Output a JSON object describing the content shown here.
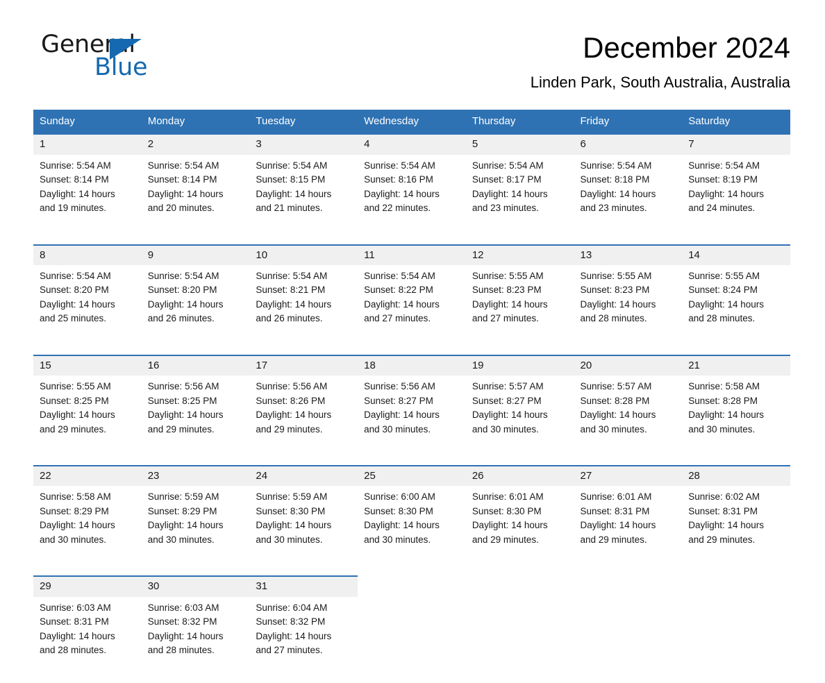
{
  "brand": {
    "name_part1": "General",
    "name_part2": "Blue",
    "flag_icon": "triangle-flag-icon",
    "accent_color": "#1569b0"
  },
  "header": {
    "title": "December 2024",
    "subtitle": "Linden Park, South Australia, Australia"
  },
  "colors": {
    "header_blue": "#2e72b4",
    "daynum_band": "#f0f0f0",
    "text": "#1a1a1a"
  },
  "calendar": {
    "weekday_headers": [
      "Sunday",
      "Monday",
      "Tuesday",
      "Wednesday",
      "Thursday",
      "Friday",
      "Saturday"
    ],
    "weeks": [
      {
        "days": [
          {
            "date": "1",
            "sunrise": "Sunrise: 5:54 AM",
            "sunset": "Sunset: 8:14 PM",
            "daylight_line1": "Daylight: 14 hours",
            "daylight_line2": "and 19 minutes."
          },
          {
            "date": "2",
            "sunrise": "Sunrise: 5:54 AM",
            "sunset": "Sunset: 8:14 PM",
            "daylight_line1": "Daylight: 14 hours",
            "daylight_line2": "and 20 minutes."
          },
          {
            "date": "3",
            "sunrise": "Sunrise: 5:54 AM",
            "sunset": "Sunset: 8:15 PM",
            "daylight_line1": "Daylight: 14 hours",
            "daylight_line2": "and 21 minutes."
          },
          {
            "date": "4",
            "sunrise": "Sunrise: 5:54 AM",
            "sunset": "Sunset: 8:16 PM",
            "daylight_line1": "Daylight: 14 hours",
            "daylight_line2": "and 22 minutes."
          },
          {
            "date": "5",
            "sunrise": "Sunrise: 5:54 AM",
            "sunset": "Sunset: 8:17 PM",
            "daylight_line1": "Daylight: 14 hours",
            "daylight_line2": "and 23 minutes."
          },
          {
            "date": "6",
            "sunrise": "Sunrise: 5:54 AM",
            "sunset": "Sunset: 8:18 PM",
            "daylight_line1": "Daylight: 14 hours",
            "daylight_line2": "and 23 minutes."
          },
          {
            "date": "7",
            "sunrise": "Sunrise: 5:54 AM",
            "sunset": "Sunset: 8:19 PM",
            "daylight_line1": "Daylight: 14 hours",
            "daylight_line2": "and 24 minutes."
          }
        ]
      },
      {
        "days": [
          {
            "date": "8",
            "sunrise": "Sunrise: 5:54 AM",
            "sunset": "Sunset: 8:20 PM",
            "daylight_line1": "Daylight: 14 hours",
            "daylight_line2": "and 25 minutes."
          },
          {
            "date": "9",
            "sunrise": "Sunrise: 5:54 AM",
            "sunset": "Sunset: 8:20 PM",
            "daylight_line1": "Daylight: 14 hours",
            "daylight_line2": "and 26 minutes."
          },
          {
            "date": "10",
            "sunrise": "Sunrise: 5:54 AM",
            "sunset": "Sunset: 8:21 PM",
            "daylight_line1": "Daylight: 14 hours",
            "daylight_line2": "and 26 minutes."
          },
          {
            "date": "11",
            "sunrise": "Sunrise: 5:54 AM",
            "sunset": "Sunset: 8:22 PM",
            "daylight_line1": "Daylight: 14 hours",
            "daylight_line2": "and 27 minutes."
          },
          {
            "date": "12",
            "sunrise": "Sunrise: 5:55 AM",
            "sunset": "Sunset: 8:23 PM",
            "daylight_line1": "Daylight: 14 hours",
            "daylight_line2": "and 27 minutes."
          },
          {
            "date": "13",
            "sunrise": "Sunrise: 5:55 AM",
            "sunset": "Sunset: 8:23 PM",
            "daylight_line1": "Daylight: 14 hours",
            "daylight_line2": "and 28 minutes."
          },
          {
            "date": "14",
            "sunrise": "Sunrise: 5:55 AM",
            "sunset": "Sunset: 8:24 PM",
            "daylight_line1": "Daylight: 14 hours",
            "daylight_line2": "and 28 minutes."
          }
        ]
      },
      {
        "days": [
          {
            "date": "15",
            "sunrise": "Sunrise: 5:55 AM",
            "sunset": "Sunset: 8:25 PM",
            "daylight_line1": "Daylight: 14 hours",
            "daylight_line2": "and 29 minutes."
          },
          {
            "date": "16",
            "sunrise": "Sunrise: 5:56 AM",
            "sunset": "Sunset: 8:25 PM",
            "daylight_line1": "Daylight: 14 hours",
            "daylight_line2": "and 29 minutes."
          },
          {
            "date": "17",
            "sunrise": "Sunrise: 5:56 AM",
            "sunset": "Sunset: 8:26 PM",
            "daylight_line1": "Daylight: 14 hours",
            "daylight_line2": "and 29 minutes."
          },
          {
            "date": "18",
            "sunrise": "Sunrise: 5:56 AM",
            "sunset": "Sunset: 8:27 PM",
            "daylight_line1": "Daylight: 14 hours",
            "daylight_line2": "and 30 minutes."
          },
          {
            "date": "19",
            "sunrise": "Sunrise: 5:57 AM",
            "sunset": "Sunset: 8:27 PM",
            "daylight_line1": "Daylight: 14 hours",
            "daylight_line2": "and 30 minutes."
          },
          {
            "date": "20",
            "sunrise": "Sunrise: 5:57 AM",
            "sunset": "Sunset: 8:28 PM",
            "daylight_line1": "Daylight: 14 hours",
            "daylight_line2": "and 30 minutes."
          },
          {
            "date": "21",
            "sunrise": "Sunrise: 5:58 AM",
            "sunset": "Sunset: 8:28 PM",
            "daylight_line1": "Daylight: 14 hours",
            "daylight_line2": "and 30 minutes."
          }
        ]
      },
      {
        "days": [
          {
            "date": "22",
            "sunrise": "Sunrise: 5:58 AM",
            "sunset": "Sunset: 8:29 PM",
            "daylight_line1": "Daylight: 14 hours",
            "daylight_line2": "and 30 minutes."
          },
          {
            "date": "23",
            "sunrise": "Sunrise: 5:59 AM",
            "sunset": "Sunset: 8:29 PM",
            "daylight_line1": "Daylight: 14 hours",
            "daylight_line2": "and 30 minutes."
          },
          {
            "date": "24",
            "sunrise": "Sunrise: 5:59 AM",
            "sunset": "Sunset: 8:30 PM",
            "daylight_line1": "Daylight: 14 hours",
            "daylight_line2": "and 30 minutes."
          },
          {
            "date": "25",
            "sunrise": "Sunrise: 6:00 AM",
            "sunset": "Sunset: 8:30 PM",
            "daylight_line1": "Daylight: 14 hours",
            "daylight_line2": "and 30 minutes."
          },
          {
            "date": "26",
            "sunrise": "Sunrise: 6:01 AM",
            "sunset": "Sunset: 8:30 PM",
            "daylight_line1": "Daylight: 14 hours",
            "daylight_line2": "and 29 minutes."
          },
          {
            "date": "27",
            "sunrise": "Sunrise: 6:01 AM",
            "sunset": "Sunset: 8:31 PM",
            "daylight_line1": "Daylight: 14 hours",
            "daylight_line2": "and 29 minutes."
          },
          {
            "date": "28",
            "sunrise": "Sunrise: 6:02 AM",
            "sunset": "Sunset: 8:31 PM",
            "daylight_line1": "Daylight: 14 hours",
            "daylight_line2": "and 29 minutes."
          }
        ]
      },
      {
        "days": [
          {
            "date": "29",
            "sunrise": "Sunrise: 6:03 AM",
            "sunset": "Sunset: 8:31 PM",
            "daylight_line1": "Daylight: 14 hours",
            "daylight_line2": "and 28 minutes."
          },
          {
            "date": "30",
            "sunrise": "Sunrise: 6:03 AM",
            "sunset": "Sunset: 8:32 PM",
            "daylight_line1": "Daylight: 14 hours",
            "daylight_line2": "and 28 minutes."
          },
          {
            "date": "31",
            "sunrise": "Sunrise: 6:04 AM",
            "sunset": "Sunset: 8:32 PM",
            "daylight_line1": "Daylight: 14 hours",
            "daylight_line2": "and 27 minutes."
          },
          {
            "date": "",
            "sunrise": "",
            "sunset": "",
            "daylight_line1": "",
            "daylight_line2": ""
          },
          {
            "date": "",
            "sunrise": "",
            "sunset": "",
            "daylight_line1": "",
            "daylight_line2": ""
          },
          {
            "date": "",
            "sunrise": "",
            "sunset": "",
            "daylight_line1": "",
            "daylight_line2": ""
          },
          {
            "date": "",
            "sunrise": "",
            "sunset": "",
            "daylight_line1": "",
            "daylight_line2": ""
          }
        ]
      }
    ]
  }
}
